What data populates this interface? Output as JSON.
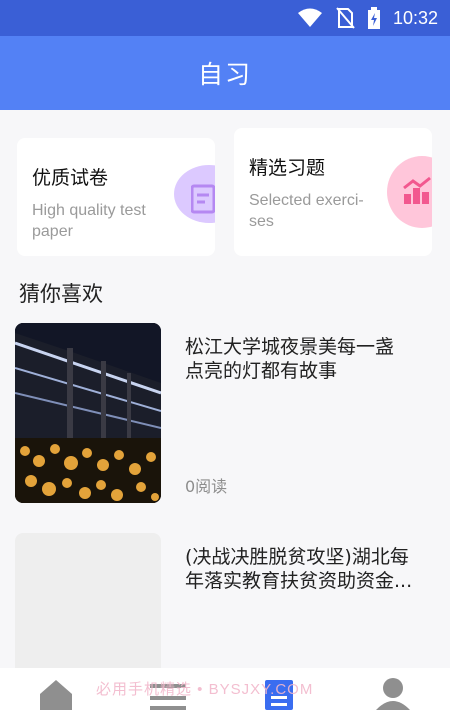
{
  "status_bar": {
    "time": "10:32"
  },
  "header": {
    "title": "自习"
  },
  "cards": [
    {
      "title": "优质试卷",
      "subtitle": "High quality test paper",
      "accent": "#dcc9ff",
      "icon": "edit-document-icon"
    },
    {
      "title": "精选习题",
      "subtitle": "Selected exerci-ses",
      "accent": "#ffc6da",
      "icon": "bar-chart-icon"
    }
  ],
  "section": {
    "title": "猜你喜欢"
  },
  "articles": [
    {
      "title_line1": "松江大学城夜景美每一盏",
      "title_line2": "点亮的灯都有故事",
      "reads": "0阅读"
    },
    {
      "title_line1": "(决战决胜脱贫攻坚)湖北每",
      "title_line2": "年落实教育扶贫资助资金..."
    }
  ],
  "watermark": "必用手机精选 • BYSJXY.COM",
  "tab_bar": {
    "icons": [
      "home-icon",
      "list-icon",
      "document-icon",
      "user-icon"
    ],
    "active_color": "#3a6df0"
  }
}
